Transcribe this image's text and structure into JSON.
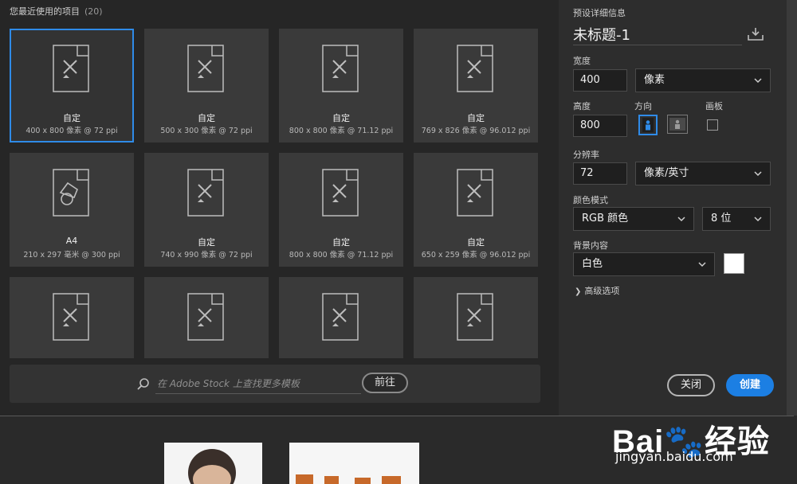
{
  "recent": {
    "title": "您最近使用的项目",
    "count": "(20)",
    "tiles": [
      {
        "name": "自定",
        "meta": "400 x 800 像素 @ 72 ppi",
        "icon": "document-pencil-icon",
        "selected": true
      },
      {
        "name": "自定",
        "meta": "500 x 300 像素 @ 72 ppi",
        "icon": "document-pencil-icon"
      },
      {
        "name": "自定",
        "meta": "800 x 800 像素 @ 71.12 ppi",
        "icon": "document-pencil-icon"
      },
      {
        "name": "自定",
        "meta": "769 x 826 像素 @ 96.012 ppi",
        "icon": "document-pencil-icon"
      },
      {
        "name": "A4",
        "meta": "210 x 297 毫米 @ 300 ppi",
        "icon": "document-shapes-icon"
      },
      {
        "name": "自定",
        "meta": "740 x 990 像素 @ 72 ppi",
        "icon": "document-pencil-icon"
      },
      {
        "name": "自定",
        "meta": "800 x 800 像素 @ 71.12 ppi",
        "icon": "document-pencil-icon"
      },
      {
        "name": "自定",
        "meta": "650 x 259 像素 @ 96.012 ppi",
        "icon": "document-pencil-icon"
      },
      {
        "name": "",
        "meta": "",
        "icon": "document-pencil-icon"
      },
      {
        "name": "",
        "meta": "",
        "icon": "document-pencil-icon"
      },
      {
        "name": "",
        "meta": "",
        "icon": "document-pencil-icon"
      },
      {
        "name": "",
        "meta": "",
        "icon": "document-pencil-icon"
      }
    ]
  },
  "stock": {
    "placeholder": "在 Adobe Stock 上查找更多模板",
    "go_label": "前往"
  },
  "details": {
    "title": "预设详细信息",
    "doc_name": "未标题-1",
    "width_label": "宽度",
    "width_value": "400",
    "width_unit": "像素",
    "height_label": "高度",
    "height_value": "800",
    "orientation_label": "方向",
    "artboard_label": "画板",
    "resolution_label": "分辨率",
    "resolution_value": "72",
    "resolution_unit": "像素/英寸",
    "color_mode_label": "颜色模式",
    "color_mode": "RGB 颜色",
    "bit_depth": "8 位",
    "background_label": "背景内容",
    "background": "白色",
    "background_color": "#ffffff",
    "advanced_label": "高级选项",
    "close_label": "关闭",
    "create_label": "创建"
  },
  "colors": {
    "accent": "#2f8be8",
    "create_button": "#1c7fe3"
  },
  "watermark": {
    "brand": "Bai🐾经验",
    "url": "jingyan.baidu.com"
  }
}
